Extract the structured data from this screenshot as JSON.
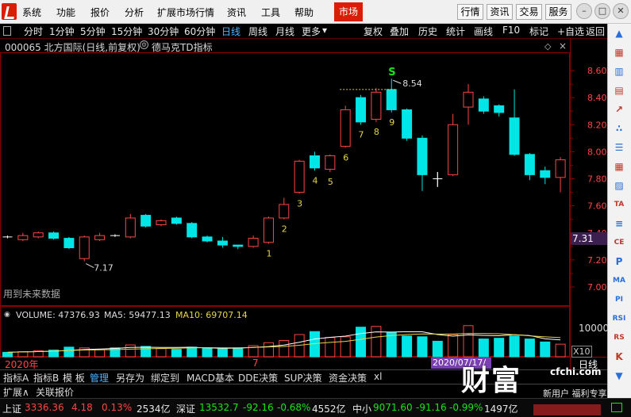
{
  "menubar": {
    "items": [
      "系统",
      "功能",
      "报价",
      "分析",
      "扩展市场行情",
      "资讯",
      "工具",
      "帮助"
    ],
    "market_button": "市场",
    "right_buttons": [
      "行情",
      "资讯",
      "交易",
      "服务"
    ]
  },
  "toolbar": {
    "periods": [
      "分时",
      "1分钟",
      "5分钟",
      "15分钟",
      "30分钟",
      "60分钟",
      "日线",
      "周线",
      "月线",
      "更多"
    ],
    "more_arrow": "▾",
    "active_period": "日线",
    "tools": [
      "复权",
      "叠加",
      "历史",
      "统计",
      "画线",
      "F10",
      "标记",
      "+自选",
      "返回"
    ]
  },
  "chart": {
    "stock_title": "000065 北方国际(日线,前复权)",
    "indicator_title": "德马克TD指标",
    "y_labels": [
      "8.60",
      "8.40",
      "8.20",
      "8.00",
      "7.80",
      "7.60",
      "7.40",
      "7.20",
      "7.00"
    ],
    "current_price": "7.31",
    "high_annot": "8.54",
    "low_annot": "7.17",
    "s_mark": "S",
    "td_counts": [
      "1",
      "2",
      "3",
      "4",
      "5",
      "6",
      "7",
      "8",
      "9"
    ],
    "no_future_text": "用到未来数据",
    "date_start": "2020年",
    "date_mid": "7",
    "cursor_date": "2020/07/17/五",
    "period_label": "日线",
    "volume_title": "VOLUME: 47376.93",
    "ma5_title": "MA5: 59477.13",
    "ma10_title": "MA10: 69707.14",
    "vol_scale": "10000",
    "vol_unit": "X10"
  },
  "chart_data": {
    "type": "candlestick",
    "y_range": [
      6.9,
      8.65
    ],
    "candles": [
      {
        "o": 7.37,
        "c": 7.37,
        "h": 7.38,
        "l": 7.36
      },
      {
        "o": 7.35,
        "c": 7.38,
        "h": 7.4,
        "l": 7.34
      },
      {
        "o": 7.37,
        "c": 7.4,
        "h": 7.41,
        "l": 7.36
      },
      {
        "o": 7.4,
        "c": 7.36,
        "h": 7.41,
        "l": 7.35
      },
      {
        "o": 7.36,
        "c": 7.29,
        "h": 7.37,
        "l": 7.28
      },
      {
        "o": 7.21,
        "c": 7.37,
        "h": 7.38,
        "l": 7.19
      },
      {
        "o": 7.35,
        "c": 7.38,
        "h": 7.4,
        "l": 7.34
      },
      {
        "o": 7.38,
        "c": 7.38,
        "h": 7.39,
        "l": 7.37
      },
      {
        "o": 7.37,
        "c": 7.51,
        "h": 7.54,
        "l": 7.36
      },
      {
        "o": 7.53,
        "c": 7.45,
        "h": 7.54,
        "l": 7.44
      },
      {
        "o": 7.46,
        "c": 7.49,
        "h": 7.5,
        "l": 7.45
      },
      {
        "o": 7.51,
        "c": 7.47,
        "h": 7.52,
        "l": 7.46
      },
      {
        "o": 7.47,
        "c": 7.37,
        "h": 7.48,
        "l": 7.36
      },
      {
        "o": 7.37,
        "c": 7.34,
        "h": 7.38,
        "l": 7.33
      },
      {
        "o": 7.34,
        "c": 7.31,
        "h": 7.37,
        "l": 7.29
      },
      {
        "o": 7.31,
        "c": 7.3,
        "h": 7.31,
        "l": 7.28
      },
      {
        "o": 7.3,
        "c": 7.36,
        "h": 7.38,
        "l": 7.29
      },
      {
        "o": 7.33,
        "c": 7.51,
        "h": 7.52,
        "l": 7.32
      },
      {
        "o": 7.51,
        "c": 7.61,
        "h": 7.66,
        "l": 7.5
      },
      {
        "o": 7.7,
        "c": 7.93,
        "h": 7.94,
        "l": 7.69
      },
      {
        "o": 7.97,
        "c": 7.88,
        "h": 8.0,
        "l": 7.86
      },
      {
        "o": 7.87,
        "c": 7.97,
        "h": 7.98,
        "l": 7.85
      },
      {
        "o": 8.04,
        "c": 8.31,
        "h": 8.34,
        "l": 8.03
      },
      {
        "o": 8.4,
        "c": 8.22,
        "h": 8.42,
        "l": 8.2
      },
      {
        "o": 8.24,
        "c": 8.44,
        "h": 8.47,
        "l": 8.22
      },
      {
        "o": 8.46,
        "c": 8.31,
        "h": 8.54,
        "l": 8.29
      },
      {
        "o": 8.31,
        "c": 8.1,
        "h": 8.32,
        "l": 8.08
      },
      {
        "o": 8.1,
        "c": 7.83,
        "h": 8.12,
        "l": 7.71
      },
      {
        "o": 7.8,
        "c": 7.8,
        "h": 7.85,
        "l": 7.74
      },
      {
        "o": 7.83,
        "c": 8.2,
        "h": 8.28,
        "l": 7.82
      },
      {
        "o": 8.33,
        "c": 8.44,
        "h": 8.5,
        "l": 8.2
      },
      {
        "o": 8.39,
        "c": 8.3,
        "h": 8.41,
        "l": 8.28
      },
      {
        "o": 8.34,
        "c": 8.29,
        "h": 8.35,
        "l": 8.26
      },
      {
        "o": 8.25,
        "c": 7.98,
        "h": 8.46,
        "l": 7.97
      },
      {
        "o": 7.98,
        "c": 7.83,
        "h": 7.99,
        "l": 7.79
      },
      {
        "o": 7.86,
        "c": 7.81,
        "h": 7.89,
        "l": 7.76
      },
      {
        "o": 7.81,
        "c": 7.94,
        "h": 7.96,
        "l": 7.7
      }
    ],
    "volumes": [
      6,
      7,
      8,
      9,
      13,
      12,
      10,
      12,
      16,
      14,
      11,
      10,
      13,
      12,
      11,
      12,
      15,
      19,
      22,
      30,
      34,
      26,
      27,
      40,
      41,
      33,
      28,
      27,
      21,
      30,
      42,
      24,
      25,
      28,
      24,
      20,
      17
    ],
    "volume_range": [
      0,
      45
    ],
    "title": "德马克TD指标"
  },
  "tabs_row1": [
    "指标A",
    "指标B",
    "模 板",
    "管理",
    "另存为",
    "绑定到",
    "MACD基本",
    "DDE决策",
    "SUP决策",
    "资金决策",
    "xl"
  ],
  "tabs_row1_active": "管理",
  "tabs_row2": [
    "扩展∧",
    "关联报价"
  ],
  "status": {
    "sh_label": "上证",
    "sh_value": "3336.36",
    "sh_change": "4.18",
    "sh_pct": "0.13%",
    "sh_amount": "2534亿",
    "sz_label": "深证",
    "sz_value": "13532.7",
    "sz_change": "-92.16",
    "sz_pct": "-0.68%",
    "sz_amount": "4552亿",
    "zx_label": "中小",
    "zx_value": "9071.60",
    "zx_change": "-91.16",
    "zx_pct": "-0.99%",
    "zx_amount": "1497亿"
  },
  "watermark": {
    "brand": "财富池",
    "domain": "cfchi.com",
    "sub": "新用户 福利专享"
  },
  "colors": {
    "up": "#ff4545",
    "down": "#00e5e5",
    "grid": "#8b0000",
    "td_count": "#e8d44a",
    "s_mark": "#19e619"
  },
  "sidebar_icons": [
    "arrow-up-icon",
    "grid-icon",
    "bar-chart-icon",
    "candle-icon",
    "trend-icon",
    "scatter-icon",
    "list-icon",
    "table-icon",
    "chart-icon",
    "ta-icon",
    "eq-icon",
    "ce-icon",
    "p-icon",
    "ma-icon",
    "pi-icon",
    "rsi-icon",
    "rs-icon",
    "k-icon",
    "arrow-down-icon"
  ]
}
